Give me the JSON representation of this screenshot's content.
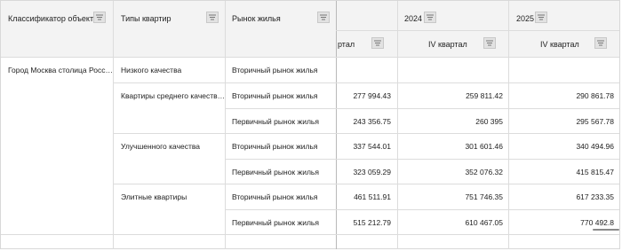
{
  "header": {
    "col1": "Классификатор объект…",
    "col2": "Типы квартир",
    "col3": "Рынок жилья",
    "year_2024": "2024",
    "year_2025": "2025",
    "q_partial": "ртал",
    "q_2024": "IV квартал",
    "q_2025": "IV квартал"
  },
  "rows": {
    "region": "Город Москва столица Росс…",
    "type_low": "Низкого качества",
    "type_mid": "Квартиры среднего качеств…",
    "type_improved": "Улучшенного качества",
    "type_elite": "Элитные квартиры",
    "market_secondary": "Вторичный рынок жилья",
    "market_primary": "Первичный рынок жилья"
  },
  "values": [
    {
      "market": "Вторичный рынок жилья",
      "c1": "",
      "c2": "",
      "c3": ""
    },
    {
      "market": "Вторичный рынок жилья",
      "c1": "277 994.43",
      "c2": "259 811.42",
      "c3": "290 861.78"
    },
    {
      "market": "Первичный рынок жилья",
      "c1": "243 356.75",
      "c2": "260 395",
      "c3": "295 567.78"
    },
    {
      "market": "Вторичный рынок жилья",
      "c1": "337 544.01",
      "c2": "301 601.46",
      "c3": "340 494.96"
    },
    {
      "market": "Первичный рынок жилья",
      "c1": "323 059.29",
      "c2": "352 076.32",
      "c3": "415 815.47"
    },
    {
      "market": "Вторичный рынок жилья",
      "c1": "461 511.91",
      "c2": "751 746.35",
      "c3": "617 233.35"
    },
    {
      "market": "Первичный рынок жилья",
      "c1": "515 212.79",
      "c2": "610 467.05",
      "c3": "770 492.8"
    }
  ],
  "icons": {
    "filter": "filter-icon"
  }
}
